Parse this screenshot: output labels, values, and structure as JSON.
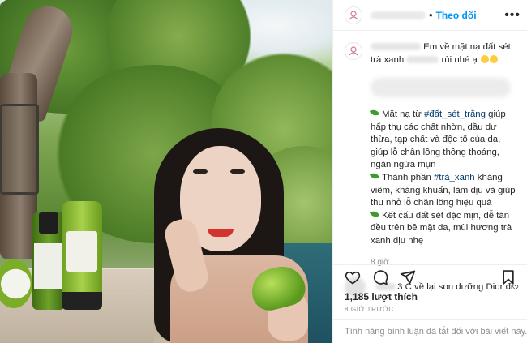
{
  "header": {
    "follow_label": "Theo dõi",
    "dot": "•",
    "more_label": "•••"
  },
  "caption": {
    "line1": "Em về mặt nạ đất sét",
    "line2_start": "trà xanh",
    "line2_end": "rùi nhé ạ"
  },
  "description": {
    "p1_pre": "Mặt nạ từ ",
    "p1_tag": "#đất_sét_trắng",
    "p1_post": " giúp hấp thụ các chất nhờn, dầu dư thừa, tạp chất và độc tố của da, giúp lỗ chân lông thông thoáng, ngăn ngừa mụn",
    "p2_pre": "Thành phần ",
    "p2_tag": "#trà_xanh",
    "p2_post": " kháng viêm, kháng khuẩn, làm dịu và giúp thu nhỏ lỗ chân lông hiệu quả",
    "p3": "Kết cấu đất sét đặc mịn, dễ tán đều trên bề mặt da, mùi hương trà xanh dịu nhẹ",
    "time": "8 giờ"
  },
  "comment": {
    "text": "3 C về lại son dưỡng Dior đi"
  },
  "post_meta": {
    "likes": "1,185 lượt thích",
    "posted": "8 GIỜ TRƯỚC"
  },
  "footer": {
    "disabled_text": "Tính năng bình luận đã tắt đối với bài viết này."
  },
  "icons": {
    "heart": "heart-icon",
    "comment": "comment-icon",
    "share": "share-icon",
    "bookmark": "bookmark-icon",
    "avatar": "brand-avatar-icon"
  },
  "colors": {
    "accent_blue": "#0095f6",
    "hashtag": "#00376b",
    "muted": "#8e8e8e"
  }
}
